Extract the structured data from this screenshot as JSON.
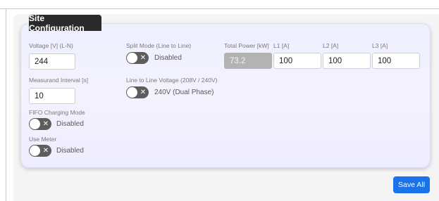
{
  "card": {
    "title": "Site Configuration"
  },
  "voltage": {
    "label": "Voltage [V] (L-N)",
    "value": "244"
  },
  "measurand": {
    "label": "Measurand Interval [s]",
    "value": "10"
  },
  "fifo": {
    "label": "FIFO Charging Mode",
    "state": "Disabled"
  },
  "use_meter": {
    "label": "Use Meter",
    "state": "Disabled"
  },
  "split_mode": {
    "label": "Split Mode (Line to Line)",
    "state": "Disabled"
  },
  "line_voltage": {
    "label": "Line to Line Voltage (208V / 240V)",
    "state": "240V (Dual Phase)"
  },
  "total_power": {
    "label": "Total Power [kW]",
    "value": "73.2"
  },
  "l1": {
    "label": "L1 [A]",
    "value": "100"
  },
  "l2": {
    "label": "L2 [A]",
    "value": "100"
  },
  "l3": {
    "label": "L3 [A]",
    "value": "100"
  },
  "toggle_symbol": "✕",
  "actions": {
    "save_label": "Save All"
  },
  "colors": {
    "accent": "#1a73e8",
    "title_bg": "#2a2a2a",
    "toggle_track": "#5d5d5d",
    "readonly_bg": "#b3b3b3"
  }
}
